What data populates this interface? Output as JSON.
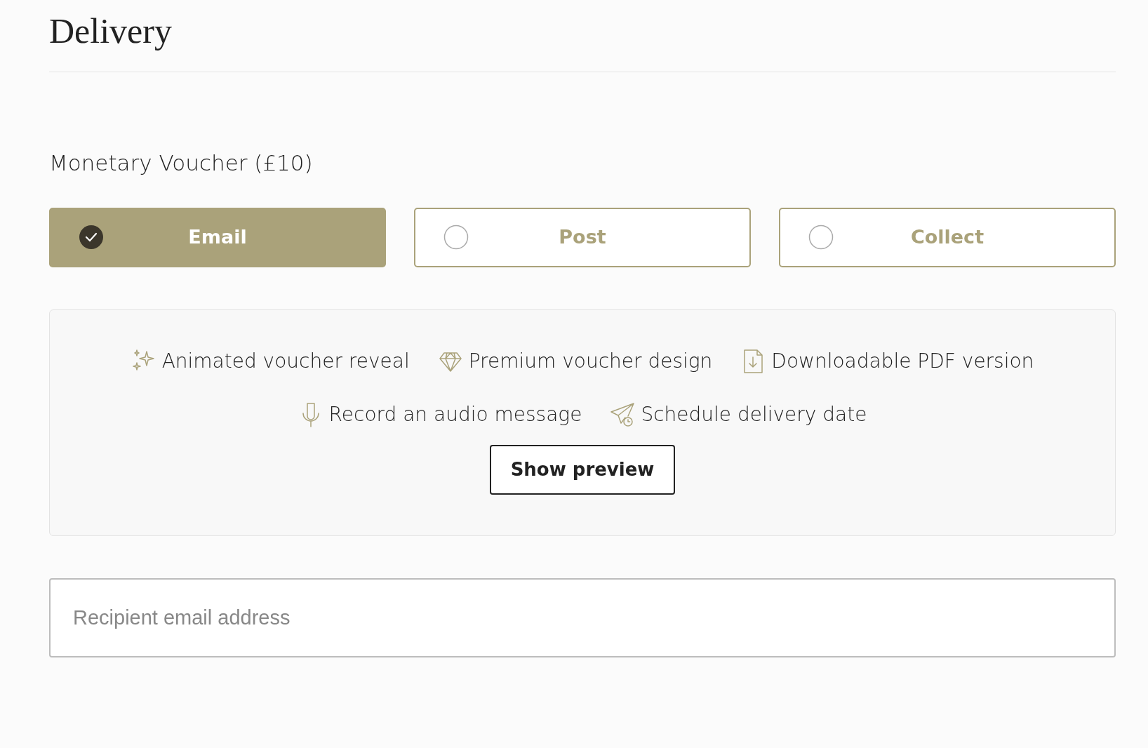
{
  "heading": "Delivery",
  "product": "Monetary Voucher (£10)",
  "delivery_options": [
    {
      "label": "Email",
      "selected": true
    },
    {
      "label": "Post",
      "selected": false
    },
    {
      "label": "Collect",
      "selected": false
    }
  ],
  "feature_rows": [
    [
      {
        "label": "Animated voucher reveal"
      },
      {
        "label": "Premium voucher design"
      },
      {
        "label": "Downloadable PDF version"
      }
    ],
    [
      {
        "label": "Record an audio message"
      },
      {
        "label": "Schedule delivery date"
      }
    ]
  ],
  "preview_button": "Show preview",
  "recipient_field": {
    "placeholder": "Recipient email address"
  }
}
